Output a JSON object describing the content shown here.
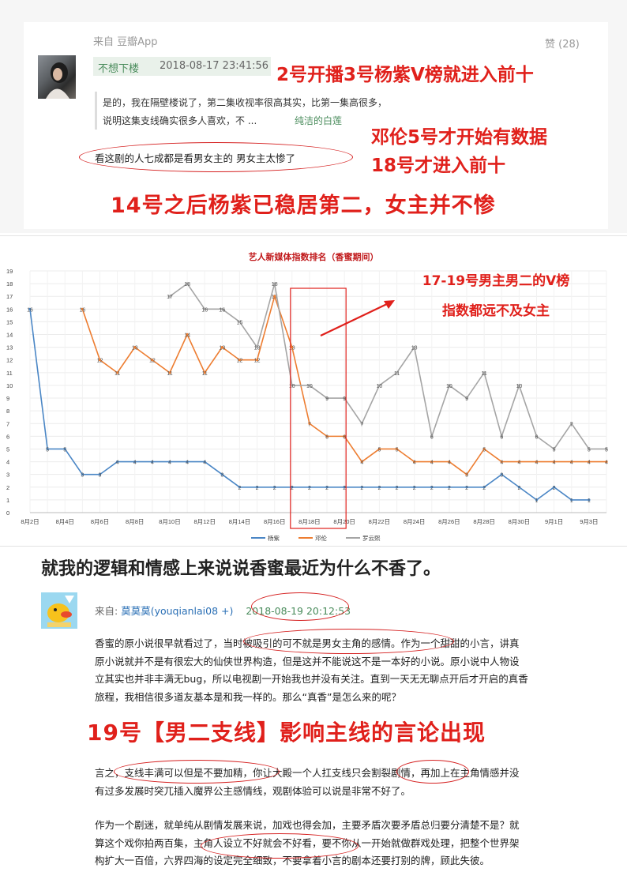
{
  "top_post": {
    "source": "来自 豆瓣App",
    "likes": "赞 (28)",
    "user": "不想下楼",
    "time": "2018-08-17 23:41:56",
    "quote_line1": "是的，我在隔壁楼说了，第二集收视率很高其实，比第一集高很多，",
    "quote_line2": "说明这集支线确实很多人喜欢，不 ...",
    "quote_author": "纯洁的白莲",
    "reply": "看这剧的人七成都是看男女主的 男女主太惨了",
    "note1": "2号开播3号杨紫V榜就进入前十",
    "note2": "邓伦5号才开始有数据",
    "note3": "18号才进入前十",
    "note4": "14号之后杨紫已稳居第二，女主并不惨",
    "accent_color": "#e0201b",
    "link_color": "#4a8c5c"
  },
  "chart_overlay": {
    "note1": "17-19号男主男二的V榜",
    "note2": "指数都远不及女主"
  },
  "chart_data": {
    "type": "line",
    "title": "艺人新媒体指数排名（香蜜期间）",
    "categories": [
      "8月2日",
      "8月3日",
      "8月4日",
      "8月5日",
      "8月6日",
      "8月7日",
      "8月8日",
      "8月9日",
      "8月10日",
      "8月11日",
      "8月12日",
      "8月13日",
      "8月14日",
      "8月15日",
      "8月16日",
      "8月17日",
      "8月18日",
      "8月19日",
      "8月20日",
      "8月21日",
      "8月22日",
      "8月23日",
      "8月24日",
      "8月25日",
      "8月26日",
      "8月27日",
      "8月28日",
      "8月29日",
      "8月30日",
      "8月31日",
      "9月1日",
      "9月2日",
      "9月3日",
      "9月4日"
    ],
    "tick_labels": [
      "8月2日",
      "8月4日",
      "8月6日",
      "8月8日",
      "8月10日",
      "8月12日",
      "8月14日",
      "8月16日",
      "8月18日",
      "8月20日",
      "8月22日",
      "8月24日",
      "8月26日",
      "8月28日",
      "8月30日",
      "9月1日",
      "9月3日"
    ],
    "ylim": [
      0,
      19
    ],
    "yticks": [
      "0",
      "1",
      "2",
      "3",
      "4",
      "5",
      "6",
      "7",
      "8",
      "9",
      "10",
      "11",
      "12",
      "13",
      "14",
      "15",
      "16",
      "17",
      "18",
      "19"
    ],
    "series": [
      {
        "name": "杨紫",
        "color": "#4a86c5",
        "values": [
          16,
          5,
          5,
          3,
          3,
          4,
          4,
          4,
          4,
          4,
          4,
          3,
          2,
          2,
          2,
          2,
          2,
          2,
          2,
          2,
          2,
          2,
          2,
          2,
          2,
          2,
          2,
          3,
          2,
          1,
          2,
          1,
          1,
          null
        ]
      },
      {
        "name": "邓伦",
        "color": "#ed7d31",
        "values": [
          null,
          null,
          null,
          16,
          12,
          11,
          13,
          12,
          11,
          14,
          11,
          13,
          12,
          12,
          17,
          13,
          7,
          6,
          6,
          4,
          5,
          5,
          4,
          4,
          4,
          3,
          5,
          4,
          4,
          4,
          4,
          4,
          4,
          4
        ]
      },
      {
        "name": "罗云熙",
        "color": "#a5a5a5",
        "values": [
          null,
          null,
          null,
          null,
          null,
          null,
          null,
          null,
          17,
          18,
          16,
          16,
          15,
          13,
          18,
          10,
          10,
          9,
          9,
          7,
          10,
          11,
          13,
          6,
          10,
          9,
          11,
          6,
          10,
          6,
          5,
          7,
          5,
          5
        ]
      }
    ],
    "grid": true,
    "legend": "bottom"
  },
  "article": {
    "title": "就我的逻辑和情感上来说说香蜜最近为什么不香了。",
    "from_label": "来自: ",
    "author": "莫莫莫(youqianlai08 +)",
    "time": "2018-08-19 20:12:53",
    "para1": [
      "香蜜的原小说很早就看过了，当时被吸引的可不就是男女主角的感情。作为一个甜甜的小言，讲真",
      "原小说就并不是有很宏大的仙侠世界构造，但是这并不能说这不是一本好的小说。原小说中人物设",
      "立其实也并非丰满无bug，所以电视剧一开始我也并没有关注。直到一天无无聊点开后才开启的真香",
      "旅程，我相信很多道友基本是和我一样的。那么“真香”是怎么来的呢？"
    ],
    "note": "19号【男二支线】影响主线的言论出现",
    "para2": [
      "言之，支线丰满可以但是不要加精，你让大殿一个人扛支线只会割裂剧情，再加上在主角情感并没",
      "有过多发展时突兀插入魔界公主感情线，观剧体验可以说是非常不好了。"
    ],
    "para3": [
      "作为一个剧迷，就单纯从剧情发展来说，加戏也得会加，主要矛盾次要矛盾总归要分清楚不是？就",
      "算这个戏你拍两百集，主角人设立不好就会不好看，要不你从一开始就做群戏处理，把整个世界架",
      "构扩大一百倍，六界四海的设定完全细致，不要拿着小言的剧本还要打别的牌，顾此失彼。"
    ]
  }
}
